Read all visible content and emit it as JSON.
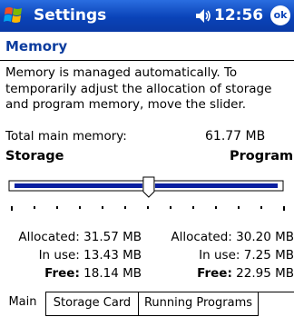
{
  "titlebar": {
    "title": "Settings",
    "time": "12:56",
    "ok_label": "ok",
    "start_icon": "windows-flag-icon",
    "volume_icon": "speaker-icon"
  },
  "page": {
    "heading": "Memory",
    "description": "Memory is managed automatically. To temporarily adjust the allocation of storage and program memory, move the slider.",
    "total_label": "Total main memory:",
    "total_value": "61.77 MB"
  },
  "slider": {
    "left_label": "Storage",
    "right_label": "Program",
    "position_fraction": 0.51
  },
  "storage_stats": {
    "allocated_label": "Allocated:",
    "allocated_value": "31.57 MB",
    "in_use_label": "In use:",
    "in_use_value": "13.43 MB",
    "free_label": "Free:",
    "free_value": "18.14 MB"
  },
  "program_stats": {
    "allocated_label": "Allocated:",
    "allocated_value": "30.20 MB",
    "in_use_label": "In use:",
    "in_use_value": "7.25 MB",
    "free_label": "Free:",
    "free_value": "22.95 MB"
  },
  "tabs": [
    {
      "label": "Main",
      "active": true
    },
    {
      "label": "Storage Card",
      "active": false
    },
    {
      "label": "Running Programs",
      "active": false
    }
  ],
  "colors": {
    "titlebar": "#0a43b8",
    "heading": "#0c3c9e",
    "slider_fill": "#0a1fa0"
  }
}
